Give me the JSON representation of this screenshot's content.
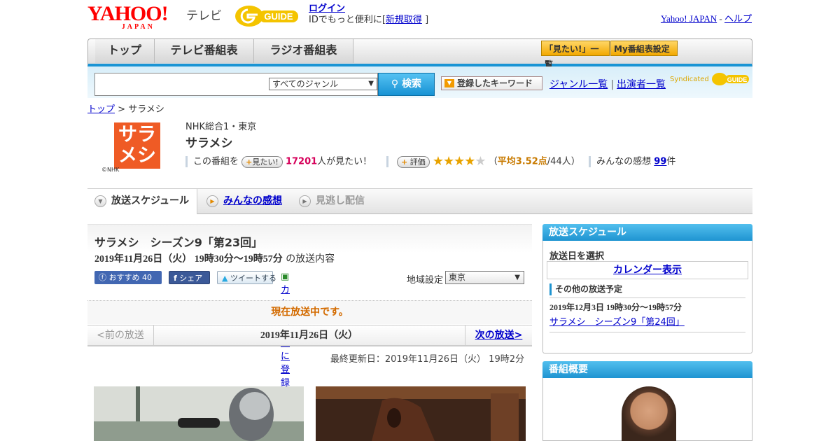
{
  "header": {
    "yahoo_logo": "YAHOO!",
    "yahoo_sub": "JAPAN",
    "tv_label": "テレビ",
    "gguide_logo": "G GUIDE",
    "login_label": "ログイン",
    "id_text_prefix": "IDでもっと便利に[",
    "signup_label": "新規取得",
    "id_text_suffix": "]",
    "yahoo_japan_link": "Yahoo! JAPAN",
    "sep": "-",
    "help_link": "ヘルプ"
  },
  "nav": {
    "tabs": [
      "トップ",
      "テレビ番組表",
      "ラジオ番組表"
    ],
    "mitai_list": "「見たい!」一覧",
    "my_guide": "My番組表設定"
  },
  "search": {
    "input_value": "",
    "genre_selected": "すべてのジャンル",
    "search_button": "検索",
    "keyword_button": "登録したキーワード",
    "genre_list_link": "ジャンル一覧",
    "link_sep": "|",
    "cast_list_link": "出演者一覧",
    "syndicated": "Syndicated"
  },
  "breadcrumb": {
    "top": "トップ",
    "sep": ">",
    "current": "サラメシ"
  },
  "program": {
    "logo_text_1": "サラ",
    "logo_text_2": "メシ",
    "logo_credit": "©NHK",
    "channel": "NHK総合1・東京",
    "title": "サラメシ",
    "mitai_prefix": "この番組を",
    "mitai_button": "見たい!",
    "mitai_count": "17201",
    "mitai_suffix": "人が見たい！",
    "rating_button": "評価",
    "rating_value": 3.52,
    "rating_open": "（",
    "rating_avg": "平均3.52点",
    "rating_count": "/44人）",
    "kanso_prefix": "みんなの感想",
    "kanso_count": "99",
    "kanso_suffix": "件"
  },
  "tabs": {
    "schedule": "放送スケジュール",
    "kanso": "みんなの感想",
    "minogashi": "見逃し配信"
  },
  "episode": {
    "title": "サラメシ　シーズン9「第23回」",
    "datetime": "2019年11月26日（火）  19時30分～19時57分",
    "datetime_suffix": "の放送内容",
    "fb_like": "おすすめ 40",
    "fb_share": "シェア",
    "tweet": "ツイートする",
    "calendar_link": "カレンダーに登録",
    "region_label": "地域設定",
    "region_selected": "東京",
    "onair": "現在放送中です。",
    "prev": "<前の放送",
    "current_date": "2019年11月26日（火）",
    "next": "次の放送>",
    "updated": "最終更新日：2019年11月26日（火） 19時2分"
  },
  "sidebar": {
    "schedule_header": "放送スケジュール",
    "select_date": "放送日を選択",
    "calendar_display": "カレンダー表示",
    "other_header": "その他の放送予定",
    "other_date": "2019年12月3日  19時30分～19時57分",
    "other_title": "サラメシ　シーズン9「第24回」",
    "overview_header": "番組概要"
  },
  "colors": {
    "accent_blue": "#1f94d1",
    "yahoo_red": "#ff0000",
    "logo_orange": "#ef5b25",
    "onair_orange": "#d36b00"
  }
}
